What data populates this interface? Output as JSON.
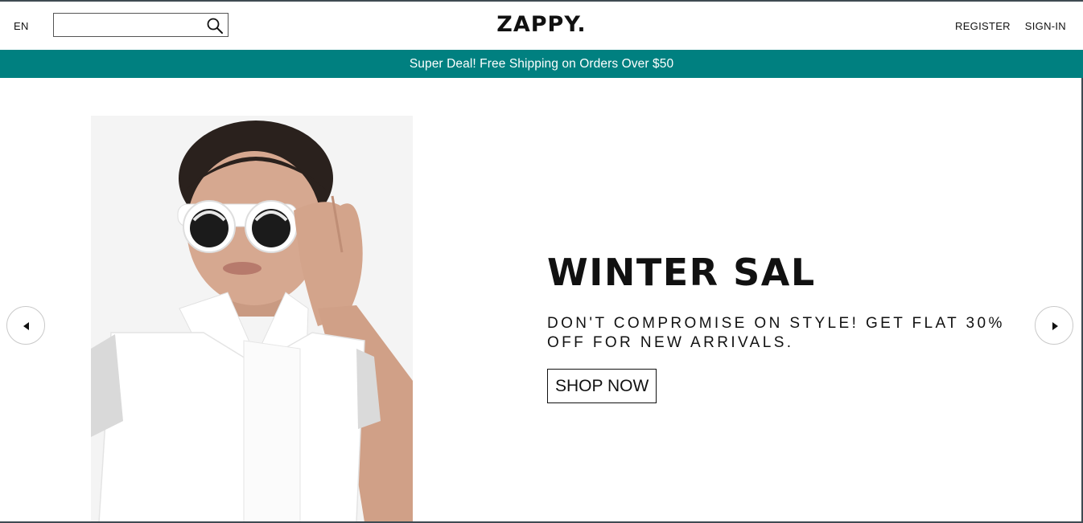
{
  "header": {
    "language": "EN",
    "search": {
      "value": "",
      "placeholder": ""
    },
    "logo": "ZAPPY.",
    "links": {
      "register": "REGISTER",
      "signin": "SIGN-IN"
    }
  },
  "promo": {
    "text": "Super Deal! Free Shipping on Orders Over $50"
  },
  "hero": {
    "title": "WINTER SAL",
    "subtitle": "DON'T COMPROMISE ON STYLE! GET FLAT 30% OFF FOR NEW ARRIVALS.",
    "cta": "SHOP NOW"
  },
  "colors": {
    "promo_background": "#008080",
    "text": "#111111",
    "background": "#ffffff"
  },
  "icons": {
    "search": "search-icon",
    "prev": "caret-left-icon",
    "next": "caret-right-icon"
  }
}
